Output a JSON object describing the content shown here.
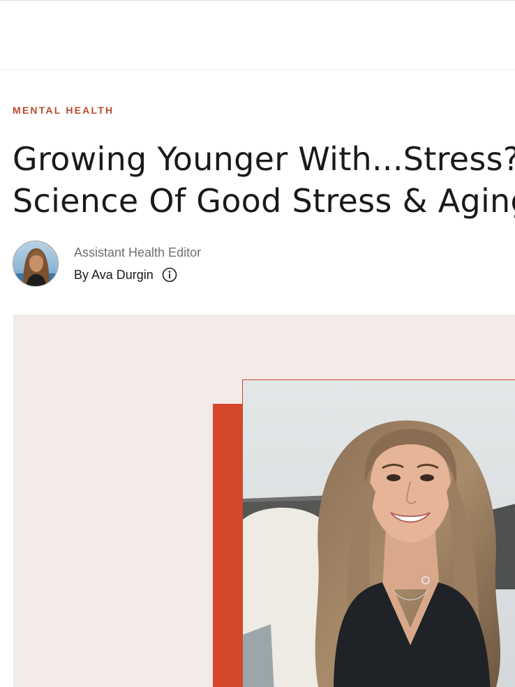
{
  "article": {
    "category": "MENTAL HEALTH",
    "title_line_1": "Growing Younger With...Stress?",
    "title_line_2": "Science Of Good Stress & Aging"
  },
  "author": {
    "role": "Assistant Health Editor",
    "byline": "By Ava Durgin",
    "info_icon": "info-icon"
  },
  "colors": {
    "category": "#b94a2b",
    "hero_background": "#f3ebe7",
    "hero_accent": "#d5472a",
    "headline": "#1a1a1a"
  }
}
